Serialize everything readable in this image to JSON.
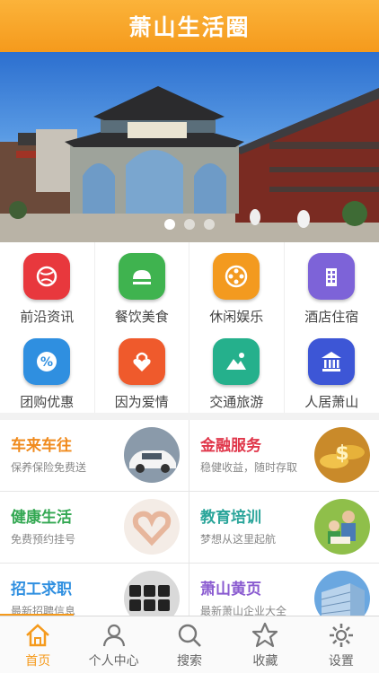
{
  "app": {
    "title": "萧山生活圈",
    "accent": "#f59a1c"
  },
  "banner": {
    "slide_count": 3,
    "active_index": 0,
    "image": "archway-gate-photo"
  },
  "categories": [
    {
      "label": "前沿资讯",
      "icon": "globe-icon",
      "color": "#e8383d"
    },
    {
      "label": "餐饮美食",
      "icon": "food-icon",
      "color": "#3fb34f"
    },
    {
      "label": "休闲娱乐",
      "icon": "film-reel-icon",
      "color": "#f39a1f"
    },
    {
      "label": "酒店住宿",
      "icon": "building-icon",
      "color": "#7d63d8"
    },
    {
      "label": "团购优惠",
      "icon": "percent-icon",
      "color": "#2f8fe0"
    },
    {
      "label": "因为爱情",
      "icon": "heart-lock-icon",
      "color": "#ef5a2c"
    },
    {
      "label": "交通旅游",
      "icon": "mountain-icon",
      "color": "#25b08c"
    },
    {
      "label": "人居萧山",
      "icon": "bank-icon",
      "color": "#3d56d6"
    }
  ],
  "services": [
    {
      "title": "车来车往",
      "subtitle": "保养保险免费送",
      "color": "#f08a1c",
      "image": "car-photo"
    },
    {
      "title": "金融服务",
      "subtitle": "稳健收益，随时存取",
      "color": "#e0364a",
      "image": "gold-coins-photo"
    },
    {
      "title": "健康生活",
      "subtitle": "免费预约挂号",
      "color": "#33a852",
      "image": "heart-hands-photo"
    },
    {
      "title": "教育培训",
      "subtitle": "梦想从这里起航",
      "color": "#2aa59a",
      "image": "family-reading-photo"
    },
    {
      "title": "招工求职",
      "subtitle": "最新招聘信息",
      "color": "#2f8fe0",
      "image": "job-keyboard-photo"
    },
    {
      "title": "萧山黄页",
      "subtitle": "最新萧山企业大全",
      "color": "#8a5bd0",
      "image": "office-building-photo"
    }
  ],
  "tabs": [
    {
      "label": "首页",
      "icon": "home-icon",
      "active": true
    },
    {
      "label": "个人中心",
      "icon": "person-icon",
      "active": false
    },
    {
      "label": "搜索",
      "icon": "search-icon",
      "active": false
    },
    {
      "label": "收藏",
      "icon": "star-icon",
      "active": false
    },
    {
      "label": "设置",
      "icon": "gear-icon",
      "active": false
    }
  ]
}
